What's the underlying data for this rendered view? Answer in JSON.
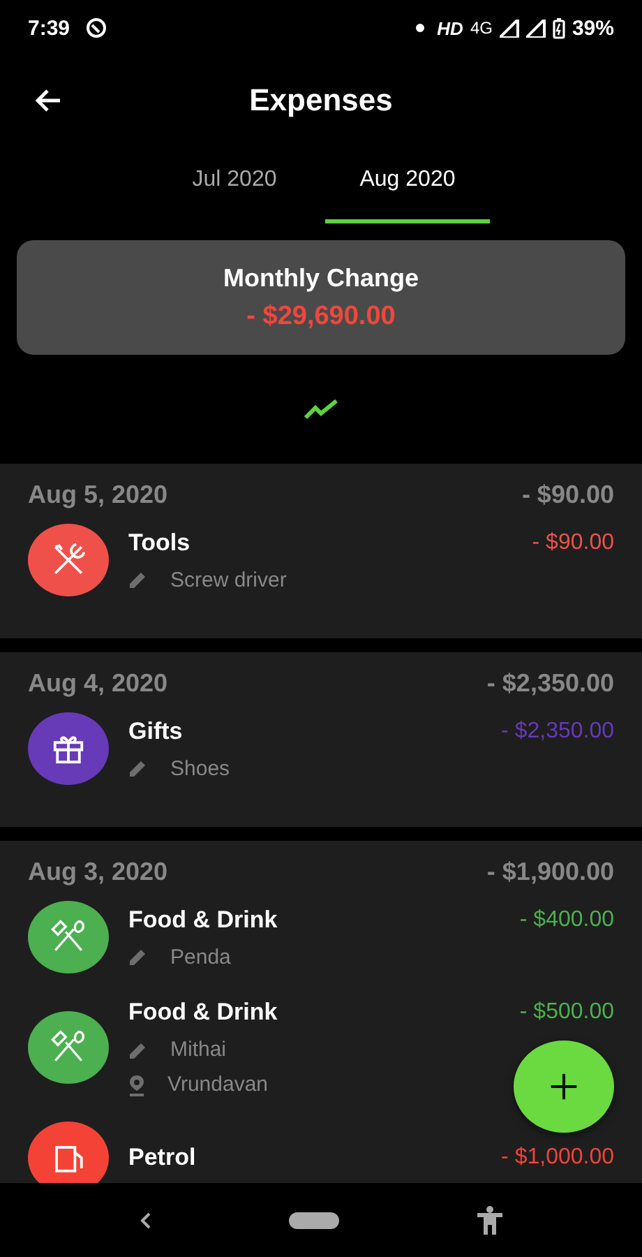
{
  "status_bar": {
    "time": "7:39",
    "network_label": "HD",
    "network_type": "4G",
    "battery": "39%"
  },
  "header": {
    "title": "Expenses"
  },
  "tabs": [
    {
      "label": "Jul 2020",
      "selected": false
    },
    {
      "label": "Aug 2020",
      "selected": true
    }
  ],
  "summary": {
    "title": "Monthly Change",
    "amount": "- $29,690.00"
  },
  "groups": [
    {
      "date": "Aug 5, 2020",
      "total": "- $90.00",
      "items": [
        {
          "category": "Tools",
          "kind": "tools",
          "color": "#f0504a",
          "amount": "- $90.00",
          "notes": [
            {
              "kind": "note",
              "text": "Screw driver"
            }
          ]
        }
      ]
    },
    {
      "date": "Aug 4, 2020",
      "total": "- $2,350.00",
      "items": [
        {
          "category": "Gifts",
          "kind": "gift",
          "color": "#673ab7",
          "amount": "- $2,350.00",
          "notes": [
            {
              "kind": "note",
              "text": "Shoes"
            }
          ]
        }
      ]
    },
    {
      "date": "Aug 3, 2020",
      "total": "- $1,900.00",
      "items": [
        {
          "category": "Food & Drink",
          "kind": "food",
          "color": "#4caf50",
          "amount": "- $400.00",
          "notes": [
            {
              "kind": "note",
              "text": "Penda"
            }
          ]
        },
        {
          "category": "Food & Drink",
          "kind": "food",
          "color": "#4caf50",
          "amount": "- $500.00",
          "notes": [
            {
              "kind": "note",
              "text": "Mithai"
            },
            {
              "kind": "place",
              "text": "Vrundavan"
            }
          ]
        },
        {
          "category": "Petrol",
          "kind": "petrol",
          "color": "#f44336",
          "amount": "- $1,000.00"
        }
      ]
    }
  ]
}
